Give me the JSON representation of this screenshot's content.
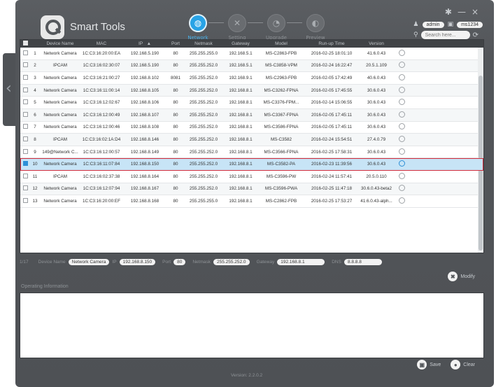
{
  "app": {
    "title": "Smart Tools"
  },
  "window_controls": {
    "settings": "✱",
    "minimize": "—",
    "close": "×"
  },
  "steps": [
    {
      "label": "Network",
      "icon": "globe-icon",
      "glyph": "◍",
      "active": true
    },
    {
      "label": "Setting",
      "icon": "tools-icon",
      "glyph": "✕",
      "active": false
    },
    {
      "label": "Upgrade",
      "icon": "upgrade-icon",
      "glyph": "◔",
      "active": false
    },
    {
      "label": "Preview",
      "icon": "preview-icon",
      "glyph": "◐",
      "active": false
    }
  ],
  "user": {
    "name": "admin",
    "password": "ms1234"
  },
  "search": {
    "placeholder": "Search here..."
  },
  "table": {
    "headers": [
      "",
      "Device Name",
      "MAC",
      "IP",
      "Port",
      "Netmask",
      "Gateway",
      "Model",
      "Run-up Time",
      "Version",
      ""
    ],
    "sort_indicator": "▲",
    "rows": [
      {
        "no": "1",
        "name": "Network Camera",
        "mac": "1C:C3:16:20:00:EA",
        "ip": "192.168.5.190",
        "port": "80",
        "netmask": "255.255.255.0",
        "gateway": "192.168.5.1",
        "model": "MS-C2863-FPB",
        "runup": "2016-02-25 18:01:10",
        "version": "41.6.0.43",
        "selected": false
      },
      {
        "no": "2",
        "name": "IPCAM",
        "mac": "1C:C3:16:02:30:07",
        "ip": "192.168.5.190",
        "port": "80",
        "netmask": "255.255.252.0",
        "gateway": "192.168.5.1",
        "model": "MS-C3858-VPM",
        "runup": "2016-02-24 16:22:47",
        "version": "20.5.1.109",
        "selected": false
      },
      {
        "no": "3",
        "name": "Network Camera",
        "mac": "1C:C3:16:21:00:27",
        "ip": "192.168.8.102",
        "port": "8081",
        "netmask": "255.255.252.0",
        "gateway": "192.168.9.1",
        "model": "MS-C2963-FPB",
        "runup": "2016-02-05 17:42:49",
        "version": "40.6.0.43",
        "selected": false
      },
      {
        "no": "4",
        "name": "Network Camera",
        "mac": "1C:C3:16:11:00:14",
        "ip": "192.168.8.105",
        "port": "80",
        "netmask": "255.255.252.0",
        "gateway": "192.168.8.1",
        "model": "MS-C3262-FPNA",
        "runup": "2016-02-05 17:45:55",
        "version": "30.6.0.43",
        "selected": false
      },
      {
        "no": "5",
        "name": "Network Camera",
        "mac": "1C:C3:16:12:02:67",
        "ip": "192.168.8.106",
        "port": "80",
        "netmask": "255.255.252.0",
        "gateway": "192.168.8.1",
        "model": "MS-C3376-FPM...",
        "runup": "2016-02-14 15:06:55",
        "version": "30.6.0.43",
        "selected": false
      },
      {
        "no": "6",
        "name": "Network Camera",
        "mac": "1C:C3:16:12:00:49",
        "ip": "192.168.8.107",
        "port": "80",
        "netmask": "255.255.252.0",
        "gateway": "192.168.8.1",
        "model": "MS-C3367-FPNA",
        "runup": "2016-02-05 17:45:11",
        "version": "30.6.0.43",
        "selected": false
      },
      {
        "no": "7",
        "name": "Network Camera",
        "mac": "1C:C3:16:12:00:46",
        "ip": "192.168.8.108",
        "port": "80",
        "netmask": "255.255.252.0",
        "gateway": "192.168.8.1",
        "model": "MS-C3586-FPNA",
        "runup": "2016-02-05 17:45:11",
        "version": "30.6.0.43",
        "selected": false
      },
      {
        "no": "8",
        "name": "IPCAM",
        "mac": "1C:C3:16:02:1A:D4",
        "ip": "192.168.8.146",
        "port": "80",
        "netmask": "255.255.252.0",
        "gateway": "192.168.8.1",
        "model": "MS-C3582",
        "runup": "2016-02-24 15:54:51",
        "version": "27.4.0.79",
        "selected": false
      },
      {
        "no": "9",
        "name": "149@Network C...",
        "mac": "1C:C3:16:12:00:57",
        "ip": "192.168.8.149",
        "port": "80",
        "netmask": "255.255.252.0",
        "gateway": "192.168.8.1",
        "model": "MS-C3566-FPNA",
        "runup": "2016-02-25 17:58:31",
        "version": "30.6.0.43",
        "selected": false
      },
      {
        "no": "10",
        "name": "Network Camera",
        "mac": "1C:C3:16:11:07:84",
        "ip": "192.168.8.150",
        "port": "80",
        "netmask": "255.255.252.0",
        "gateway": "192.168.8.1",
        "model": "MS-C3582-PA",
        "runup": "2016-02-23 11:39:56",
        "version": "30.6.0.43",
        "selected": true
      },
      {
        "no": "11",
        "name": "IPCAM",
        "mac": "1C:C3:16:02:37:38",
        "ip": "192.168.8.164",
        "port": "80",
        "netmask": "255.255.252.0",
        "gateway": "192.168.8.1",
        "model": "MS-C3596-PW",
        "runup": "2016-02-24 11:57:41",
        "version": "20.5.0.110",
        "selected": false
      },
      {
        "no": "12",
        "name": "Network Camera",
        "mac": "1C:C3:16:12:07:94",
        "ip": "192.168.8.167",
        "port": "80",
        "netmask": "255.255.252.0",
        "gateway": "192.168.8.1",
        "model": "MS-C3596-PWA",
        "runup": "2016-02-25 11:47:18",
        "version": "30.6.0.43-beta2",
        "selected": false
      },
      {
        "no": "13",
        "name": "Network Camera",
        "mac": "1C:C3:16:20:00:EF",
        "ip": "192.168.8.168",
        "port": "80",
        "netmask": "255.255.255.0",
        "gateway": "192.168.8.1",
        "model": "MS-C2862-FPB",
        "runup": "2016-02-25 17:53:27",
        "version": "41.6.0.43-alph...",
        "selected": false
      }
    ]
  },
  "editbar": {
    "count": "1/17",
    "device_name_label": "Device Name",
    "device_name_value": "Network Camera",
    "ip_label": "IP",
    "ip_value": "192.168.8.150",
    "port_label": "Port",
    "port_value": "80",
    "netmask_label": "Netmask",
    "netmask_value": "255.255.252.0",
    "gateway_label": "Gateway",
    "gateway_value": "192.168.8.1",
    "dns_label": "DNS",
    "dns_value": "8.8.8.8"
  },
  "modify_label": "Modify",
  "operating_info_label": "Operating Information",
  "footer": {
    "save_label": "Save",
    "clear_label": "Clear",
    "version": "Version: 2.2.0.2"
  }
}
